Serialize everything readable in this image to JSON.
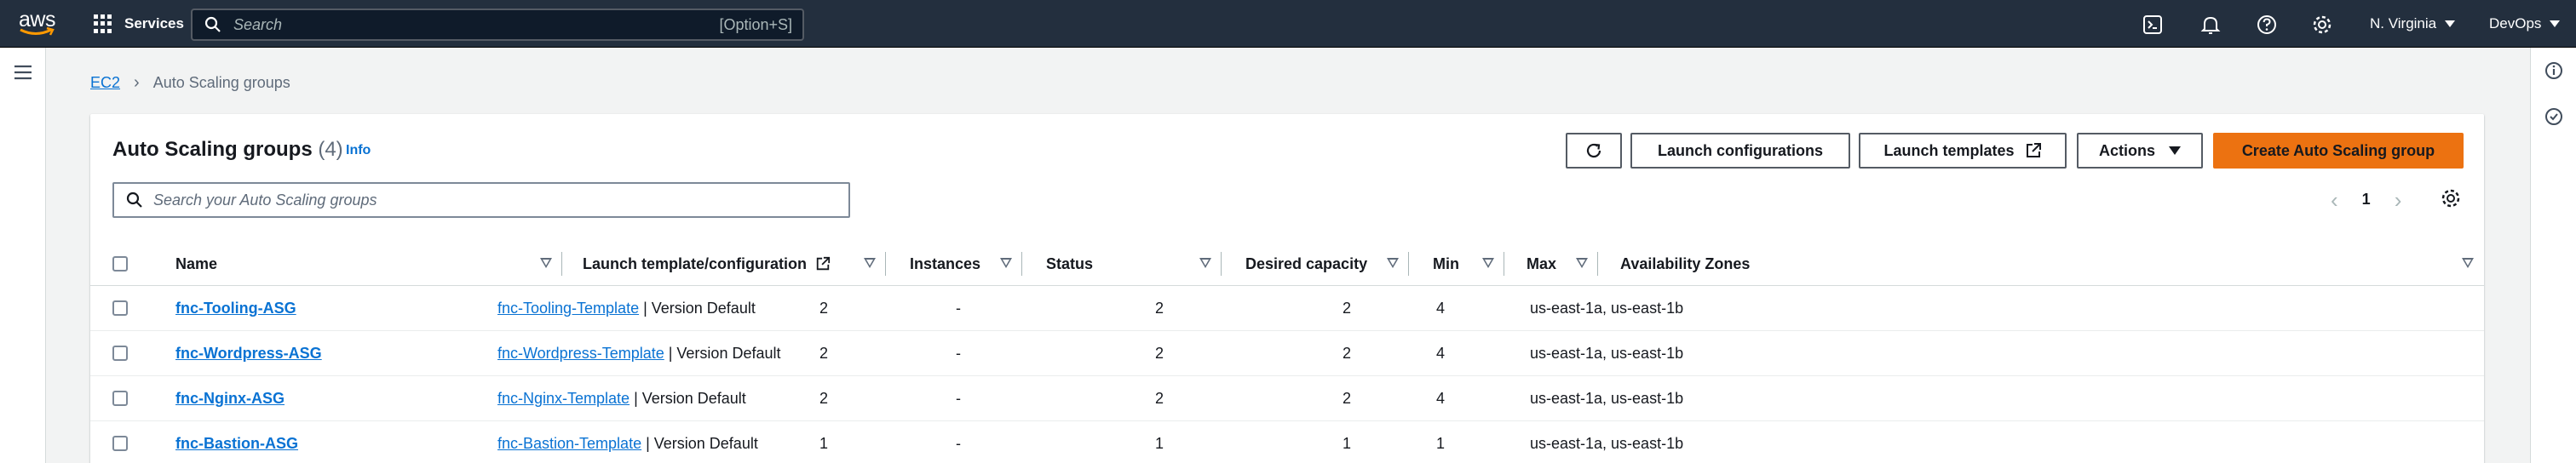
{
  "topnav": {
    "logo_text": "aws",
    "services_label": "Services",
    "search_placeholder": "Search",
    "search_shortcut": "[Option+S]",
    "region": "N. Virginia",
    "account": "DevOps"
  },
  "breadcrumb": {
    "parent": "EC2",
    "current": "Auto Scaling groups"
  },
  "header": {
    "title": "Auto Scaling groups",
    "count": "(4)",
    "info": "Info",
    "launch_configurations_label": "Launch configurations",
    "launch_templates_label": "Launch templates",
    "actions_label": "Actions",
    "create_label": "Create Auto Scaling group"
  },
  "table_search": {
    "placeholder": "Search your Auto Scaling groups"
  },
  "pagination": {
    "current_page": "1"
  },
  "columns": {
    "name": "Name",
    "launch_template": "Launch template/configuration",
    "instances": "Instances",
    "status": "Status",
    "desired": "Desired capacity",
    "min": "Min",
    "max": "Max",
    "azs": "Availability Zones"
  },
  "rows": [
    {
      "name": "fnc-Tooling-ASG",
      "template": "fnc-Tooling-Template",
      "version": " | Version Default",
      "instances": "2",
      "status": "-",
      "desired": "2",
      "min": "2",
      "max": "4",
      "azs": "us-east-1a, us-east-1b"
    },
    {
      "name": "fnc-Wordpress-ASG",
      "template": "fnc-Wordpress-Template",
      "version": " | Version Default",
      "instances": "2",
      "status": "-",
      "desired": "2",
      "min": "2",
      "max": "4",
      "azs": "us-east-1a, us-east-1b"
    },
    {
      "name": "fnc-Nginx-ASG",
      "template": "fnc-Nginx-Template",
      "version": " | Version Default",
      "instances": "2",
      "status": "-",
      "desired": "2",
      "min": "2",
      "max": "4",
      "azs": "us-east-1a, us-east-1b"
    },
    {
      "name": "fnc-Bastion-ASG",
      "template": "fnc-Bastion-Template",
      "version": " | Version Default",
      "instances": "1",
      "status": "-",
      "desired": "1",
      "min": "1",
      "max": "1",
      "azs": "us-east-1a, us-east-1b"
    }
  ],
  "colors": {
    "nav_bg": "#232f3e",
    "link": "#0972d3",
    "primary": "#ec7211"
  }
}
